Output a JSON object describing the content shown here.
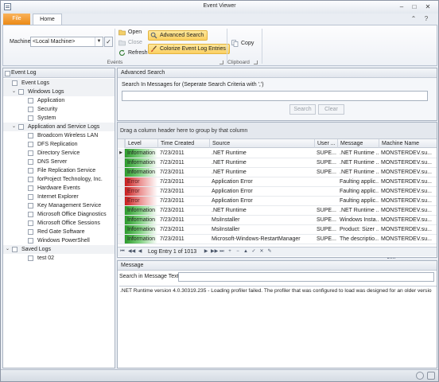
{
  "window": {
    "title": "Event Viewer"
  },
  "ribbon": {
    "file_tab": "File",
    "home_tab": "Home",
    "machine_label": "Machine",
    "machine_value": "<Local Machine>",
    "open_label": "Open",
    "close_label": "Close",
    "refresh_label": "Refresh",
    "events_group": "Events",
    "advanced_search_label": "Advanced Search",
    "colorize_label": "Colorize Event Log Entries",
    "copy_label": "Copy",
    "clipboard_group": "Clipboard"
  },
  "eventlog": {
    "header": "Event Log",
    "tree": [
      {
        "label": "Event Logs",
        "depth": 0,
        "expander": "",
        "group": true
      },
      {
        "label": "Windows Logs",
        "depth": 1,
        "expander": "⌄",
        "group": true
      },
      {
        "label": "Application",
        "depth": 2,
        "expander": "",
        "group": false
      },
      {
        "label": "Security",
        "depth": 2,
        "expander": "",
        "group": false
      },
      {
        "label": "System",
        "depth": 2,
        "expander": "",
        "group": false
      },
      {
        "label": "Application and Service Logs",
        "depth": 1,
        "expander": "⌄",
        "group": true
      },
      {
        "label": "Broadcom Wireless LAN",
        "depth": 2,
        "expander": "",
        "group": false
      },
      {
        "label": "DFS Replication",
        "depth": 2,
        "expander": "",
        "group": false
      },
      {
        "label": "Directory Service",
        "depth": 2,
        "expander": "",
        "group": false
      },
      {
        "label": "DNS Server",
        "depth": 2,
        "expander": "",
        "group": false
      },
      {
        "label": "File Replication Service",
        "depth": 2,
        "expander": "",
        "group": false
      },
      {
        "label": "forProject Technology, Inc.",
        "depth": 2,
        "expander": "",
        "group": false
      },
      {
        "label": "Hardware Events",
        "depth": 2,
        "expander": "",
        "group": false
      },
      {
        "label": "Internet Explorer",
        "depth": 2,
        "expander": "",
        "group": false
      },
      {
        "label": "Key Management Service",
        "depth": 2,
        "expander": "",
        "group": false
      },
      {
        "label": "Microsoft Office Diagnostics",
        "depth": 2,
        "expander": "",
        "group": false
      },
      {
        "label": "Microsoft Office Sessions",
        "depth": 2,
        "expander": "",
        "group": false
      },
      {
        "label": "Red Gate Software",
        "depth": 2,
        "expander": "",
        "group": false
      },
      {
        "label": "Windows PowerShell",
        "depth": 2,
        "expander": "",
        "group": false
      },
      {
        "label": "Saved Logs",
        "depth": 0,
        "expander": "⌄",
        "group": true
      },
      {
        "label": "test 02",
        "depth": 2,
        "expander": "",
        "group": false
      }
    ]
  },
  "advanced_search": {
    "header": "Advanced Search",
    "label": "Search In Messages for (Seperate Search Criteria with ',')",
    "search_button": "Search",
    "clear_button": "Clear"
  },
  "grid": {
    "group_hint": "Drag a column header here to group by that column",
    "columns": [
      "Level",
      "Time Created",
      "Source",
      "User ...",
      "Message",
      "Machine Name"
    ],
    "rows": [
      {
        "level": "Information",
        "kind": "info",
        "time": "7/23/2011",
        "source": ".NET Runtime",
        "user": "SUPE...",
        "message": ".NET Runtime ...",
        "machine": "MONSTERDEV.su...",
        "current": true
      },
      {
        "level": "Information",
        "kind": "info",
        "time": "7/23/2011",
        "source": ".NET Runtime",
        "user": "SUPE...",
        "message": ".NET Runtime ...",
        "machine": "MONSTERDEV.su...",
        "current": false
      },
      {
        "level": "Information",
        "kind": "info",
        "time": "7/23/2011",
        "source": ".NET Runtime",
        "user": "SUPE...",
        "message": ".NET Runtime ...",
        "machine": "MONSTERDEV.su...",
        "current": false
      },
      {
        "level": "Error",
        "kind": "error",
        "time": "7/23/2011",
        "source": "Application Error",
        "user": "",
        "message": "Faulting applic...",
        "machine": "MONSTERDEV.su...",
        "current": false
      },
      {
        "level": "Error",
        "kind": "error",
        "time": "7/23/2011",
        "source": "Application Error",
        "user": "",
        "message": "Faulting applic...",
        "machine": "MONSTERDEV.su...",
        "current": false
      },
      {
        "level": "Error",
        "kind": "error",
        "time": "7/23/2011",
        "source": "Application Error",
        "user": "",
        "message": "Faulting applic...",
        "machine": "MONSTERDEV.su...",
        "current": false
      },
      {
        "level": "Information",
        "kind": "info",
        "time": "7/23/2011",
        "source": ".NET Runtime",
        "user": "SUPE...",
        "message": ".NET Runtime ...",
        "machine": "MONSTERDEV.su...",
        "current": false
      },
      {
        "level": "Information",
        "kind": "info",
        "time": "7/23/2011",
        "source": "MsiInstaller",
        "user": "SUPE...",
        "message": "Windows Insta...",
        "machine": "MONSTERDEV.su...",
        "current": false
      },
      {
        "level": "Information",
        "kind": "info",
        "time": "7/23/2011",
        "source": "MsiInstaller",
        "user": "SUPE...",
        "message": "Product: Sizer ...",
        "machine": "MONSTERDEV.su...",
        "current": false
      },
      {
        "level": "Information",
        "kind": "info",
        "time": "7/23/2011",
        "source": "Microsoft-Windows-RestartManager",
        "user": "SUPE...",
        "message": "The descriptio...",
        "machine": "MONSTERDEV.su...",
        "current": false
      }
    ],
    "nav_text": "Log Entry 1 of 1013",
    "nav_first_icons": [
      "⏮",
      "◀◀",
      "◀"
    ],
    "nav_last_icons": [
      "▶",
      "▶▶",
      "⏭",
      "+",
      "−",
      "▲",
      "✓",
      "✕",
      "✎"
    ]
  },
  "message": {
    "header": "Message",
    "search_label": "Search in Message Text",
    "text": ".NET Runtime version 4.0.30319.235 - Loading profiler failed.   The profiler that was configured to load was designed for an older versio"
  },
  "colors": {
    "accent_orange": "#ec8a16",
    "info_green": "#2b9a2b",
    "error_red": "#c81c1c",
    "highlight_yellow": "#fbd062"
  }
}
